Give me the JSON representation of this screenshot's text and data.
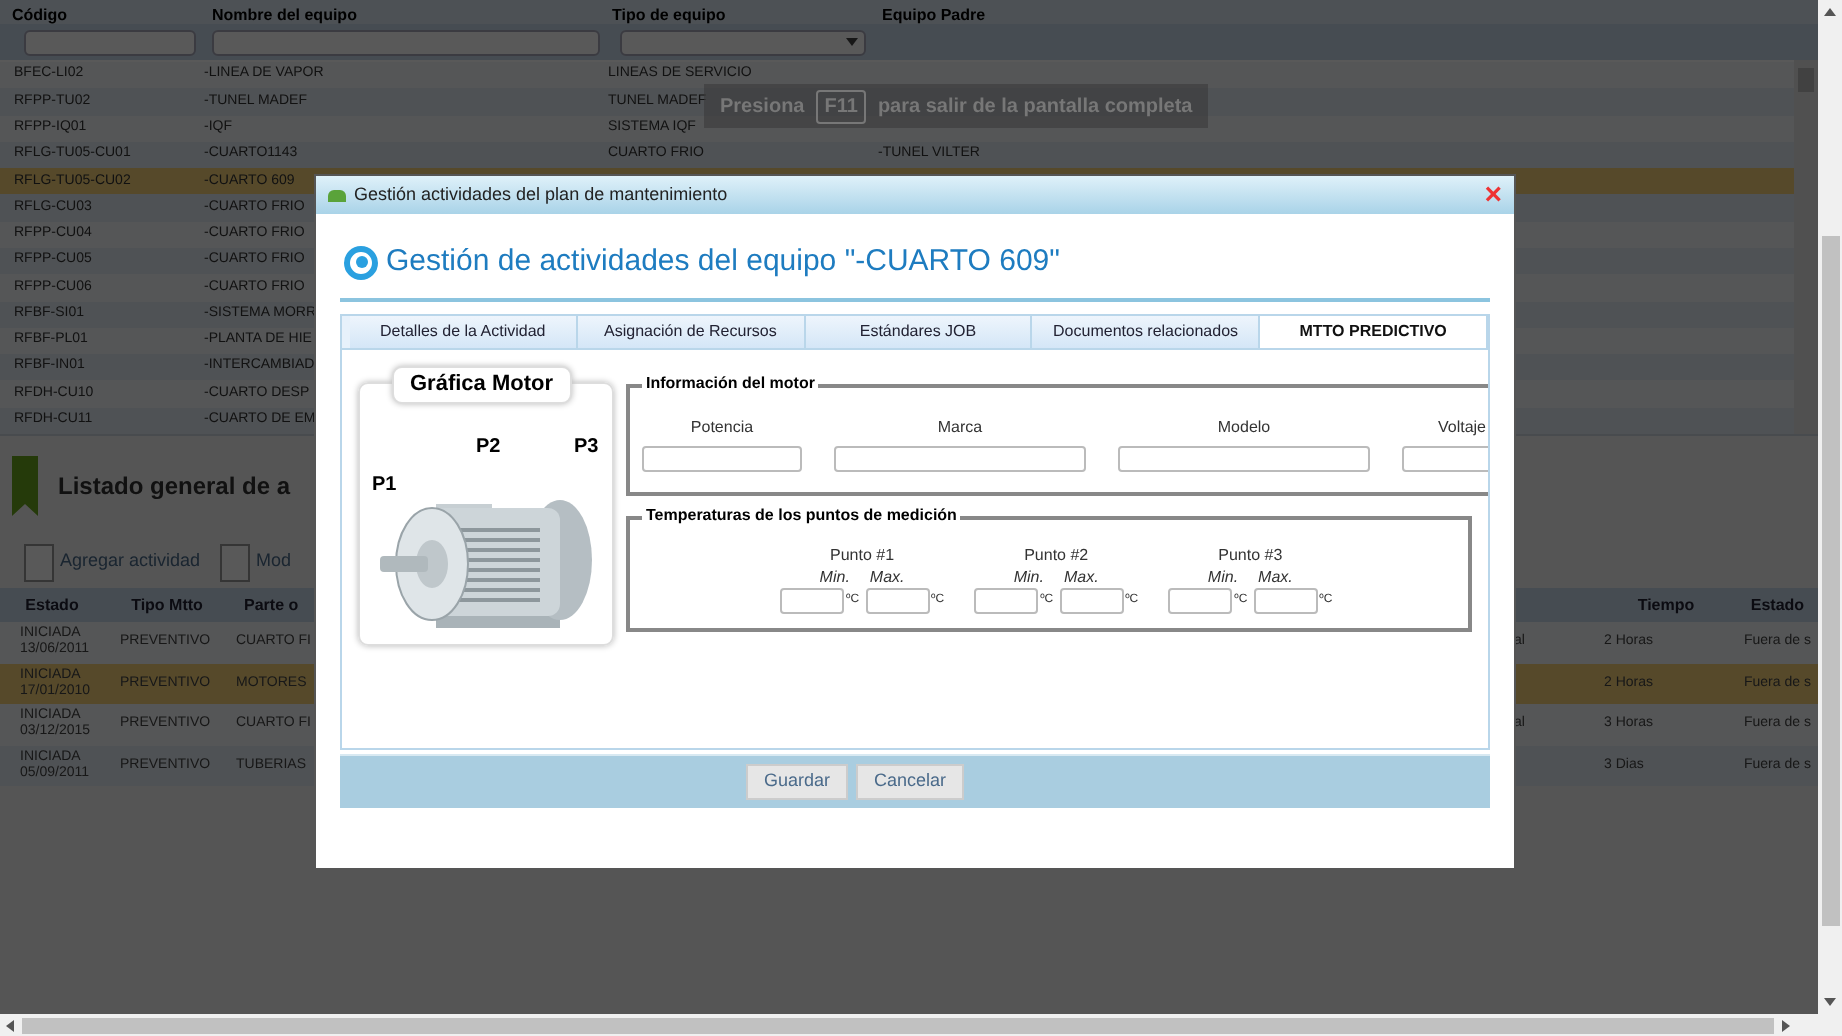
{
  "top_table": {
    "columns": [
      "Código",
      "Nombre del equipo",
      "Tipo de equipo",
      "Equipo Padre"
    ],
    "rows": [
      {
        "code": "BFEC-LI02",
        "name": "-LINEA DE VAPOR",
        "type": "LINEAS DE SERVICIO",
        "selected": false
      },
      {
        "code": "RFPP-TU02",
        "name": "-TUNEL MADEF",
        "type": "TUNEL MADEF",
        "selected": false
      },
      {
        "code": "RFPP-IQ01",
        "name": "-IQF",
        "type": "SISTEMA IQF",
        "selected": false
      },
      {
        "code": "RFLG-TU05-CU01",
        "name": "-CUARTO1143",
        "type": "CUARTO FRIO",
        "parent": "-TUNEL VILTER",
        "selected": false
      },
      {
        "code": "RFLG-TU05-CU02",
        "name": "-CUARTO 609",
        "selected": true
      },
      {
        "code": "RFLG-CU03",
        "name": "-CUARTO FRIO",
        "selected": false
      },
      {
        "code": "RFPP-CU04",
        "name": "-CUARTO FRIO",
        "selected": false
      },
      {
        "code": "RFPP-CU05",
        "name": "-CUARTO FRIO",
        "selected": false
      },
      {
        "code": "RFPP-CU06",
        "name": "-CUARTO FRIO",
        "selected": false
      },
      {
        "code": "RFBF-SI01",
        "name": "-SISTEMA MORR",
        "selected": false
      },
      {
        "code": "RFBF-PL01",
        "name": "-PLANTA DE HIE",
        "selected": false
      },
      {
        "code": "RFBF-IN01",
        "name": "-INTERCAMBIAD",
        "selected": false
      },
      {
        "code": "RFDH-CU10",
        "name": "-CUARTO DESP",
        "selected": false
      },
      {
        "code": "RFDH-CU11",
        "name": "-CUARTO DE EM",
        "selected": false
      }
    ]
  },
  "fullscreen_notice": {
    "before": "Presiona",
    "key": "F11",
    "after": "para salir de la pantalla completa"
  },
  "list_title": "Listado general de a",
  "toolbar": [
    "Agregar actividad",
    "Mod"
  ],
  "activities": {
    "columns": [
      "Estado",
      "Tipo Mtto",
      "Parte o",
      "Tiempo",
      "Estado"
    ],
    "rows": [
      {
        "status": "INICIADA",
        "date": "13/06/2011",
        "type": "PREVENTIVO",
        "part": "CUARTO FI",
        "column_4": "al",
        "time": "2 Horas",
        "state": "Fuera de s",
        "selected": false
      },
      {
        "status": "INICIADA",
        "date": "17/01/2010",
        "type": "PREVENTIVO",
        "part": "MOTORES",
        "time": "2 Horas",
        "state": "Fuera de s",
        "selected": true
      },
      {
        "status": "INICIADA",
        "date": "03/12/2015",
        "type": "PREVENTIVO",
        "part": "CUARTO FI",
        "column_4": "al",
        "time": "3 Horas",
        "state": "Fuera de s",
        "selected": false
      },
      {
        "status": "INICIADA",
        "date": "05/09/2011",
        "type": "PREVENTIVO",
        "part": "TUBERIAS",
        "time": "3 Dias",
        "state": "Fuera de s",
        "selected": false
      }
    ]
  },
  "dialog": {
    "title": "Gestión actividades del plan de mantenimiento",
    "close": "×",
    "heading": "Gestión de actividades del equipo \"-CUARTO 609\"",
    "tabs": [
      {
        "label": "Detalles de la Actividad",
        "selected": false
      },
      {
        "label": "Asignación de Recursos",
        "selected": false
      },
      {
        "label": "Estándares JOB",
        "selected": false
      },
      {
        "label": "Documentos relacionados",
        "selected": false
      },
      {
        "label": "MTTO PREDICTIVO",
        "selected": true
      }
    ],
    "motor_card": {
      "title": "Gráfica Motor",
      "points": [
        "P1",
        "P2",
        "P3"
      ]
    },
    "motor_info": {
      "legend": "Información del motor",
      "fields": [
        "Potencia",
        "Marca",
        "Modelo",
        "Voltaje"
      ]
    },
    "temperatures": {
      "legend": "Temperaturas de los puntos de medición",
      "points": [
        {
          "label": "Punto #1",
          "min": "Min.",
          "max": "Max.",
          "min_unit": "ºC",
          "max_unit": "ºC"
        },
        {
          "label": "Punto #2",
          "min": "Min.",
          "max": "Max.",
          "min_unit": "ºC",
          "max_unit": "ºC"
        },
        {
          "label": "Punto #3",
          "min": "Min.",
          "max": "Max.",
          "min_unit": "ºC",
          "max_unit": "ºC"
        }
      ]
    },
    "buttons": [
      "Guardar",
      "Cancelar"
    ]
  }
}
